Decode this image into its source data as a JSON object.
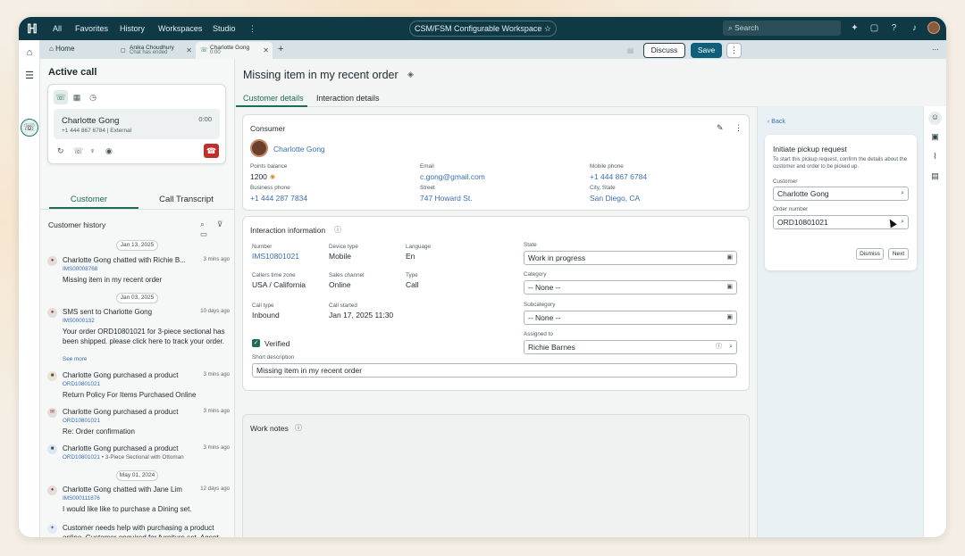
{
  "topnav": {
    "items": [
      "All",
      "Favorites",
      "History",
      "Workspaces",
      "Studio"
    ],
    "more": "⋮",
    "workspace": "CSM/FSM Configurable Workspace",
    "search_placeholder": "Search",
    "overflow": "..."
  },
  "tabs": [
    {
      "label": "Home"
    },
    {
      "label": "Anika Choudhury",
      "sub": "Chat has ended"
    },
    {
      "label": "Charlotte Gong",
      "sub": "0:00"
    }
  ],
  "add_tab": "+",
  "active_call": {
    "title": "Active call",
    "caller_name": "Charlotte Gong",
    "caller_number": "+1 444 867 6784 | External",
    "timer": "0:00"
  },
  "left_tabs": [
    "Customer",
    "Call Transcript"
  ],
  "customer_history": {
    "title": "Customer history",
    "dates": [
      "Jan 13, 2025",
      "Jan 03, 2025",
      "May 01, 2024"
    ],
    "items": [
      {
        "line": "Charlotte Gong chatted with  Richie B...",
        "time": "3 mins ago",
        "id": "IMS00008768",
        "body": "Missing item in my recent order"
      },
      {
        "line": "SMS sent to Charlotte Gong",
        "time": "10 days ago",
        "id": "IMS0000132",
        "body": "Your order ORD10801021 for 3-piece sectional has been shipped. please click here to track your order.",
        "more": "See more"
      },
      {
        "line": "Charlotte Gong purchased a product",
        "time": "3 mins ago",
        "id": "ORD10801021",
        "body": "Return Policy For Items Purchased Online"
      },
      {
        "line": "Charlotte Gong purchased a product",
        "time": "3 mins ago",
        "id": "ORD10801021",
        "body": "Re: Order confirmation"
      },
      {
        "line": "Charlotte Gong purchased a product",
        "time": "3 mins ago",
        "id": "ORD10801021",
        "id_extra": " • 3-Piece Sectional with Ottoman",
        "body": ""
      },
      {
        "line": "Charlotte Gong chatted with  Jane Lim",
        "time": "12 days ago",
        "id": "IMS000111876",
        "body": "I would like like to purchase a Dining set."
      },
      {
        "line": "",
        "time": "",
        "id": "",
        "body": "Customer needs help with purchasing a product online. Customer enquired for furniture set. Agent helped with furniture configurations."
      }
    ]
  },
  "main": {
    "title": "Missing item in my recent order",
    "tabs": [
      "Customer details",
      "Interaction details"
    ],
    "discuss": "Discuss",
    "save": "Save",
    "more": "⋮",
    "consumer": {
      "title": "Consumer",
      "name": "Charlotte Gong",
      "points_label": "Points balance",
      "points_value": "1200",
      "email_label": "Email",
      "email_value": "c.gong@gmail.com",
      "mobile_label": "Mobile phone",
      "mobile_value": "+1 444 867 6784",
      "business_label": "Business phone",
      "business_value": "+1 444 287 7834",
      "street_label": "Street",
      "street_value": "747 Howard St.",
      "city_label": "City, State",
      "city_value": "San Diego, CA"
    },
    "interaction": {
      "title": "Interaction information",
      "number_label": "Number",
      "number_value": "IMS10801021",
      "device_label": "Device type",
      "device_value": "Mobile",
      "language_label": "Language",
      "language_value": "En",
      "tz_label": "Callers time zone",
      "tz_value": "USA / California",
      "channel_label": "Sales channel",
      "channel_value": "Online",
      "type_label": "Type",
      "type_value": "Call",
      "calltype_label": "Call type",
      "calltype_value": "Inbound",
      "started_label": "Call started",
      "started_value": "Jan 17, 2025 11:30",
      "verified": "Verified",
      "short_desc_label": "Short description",
      "short_desc_value": "Missing item in my recent order",
      "state_label": "State",
      "state_value": "Work in progress",
      "category_label": "Category",
      "category_value": "-- None --",
      "subcategory_label": "Subcategory",
      "subcategory_value": "-- None --",
      "assigned_label": "Assigned to",
      "assigned_value": "Richie Barnes"
    },
    "work_notes": {
      "title": "Work notes"
    }
  },
  "pickup": {
    "back": "Back",
    "title": "Initiate pickup request",
    "desc": "To start this pickup request, confirm the details about the customer and order to be picked up.",
    "customer_label": "Customer",
    "customer_value": "Charlotte Gong",
    "order_label": "Order number",
    "order_value": "ORD10801021",
    "dismiss": "Dismiss",
    "next": "Next"
  },
  "colors": {
    "nav_bg": "#0f3a45",
    "accent": "#1d6b5a",
    "save_bg": "#0f5f7a",
    "link": "#3a6fb4",
    "hangup": "#c0302a"
  }
}
